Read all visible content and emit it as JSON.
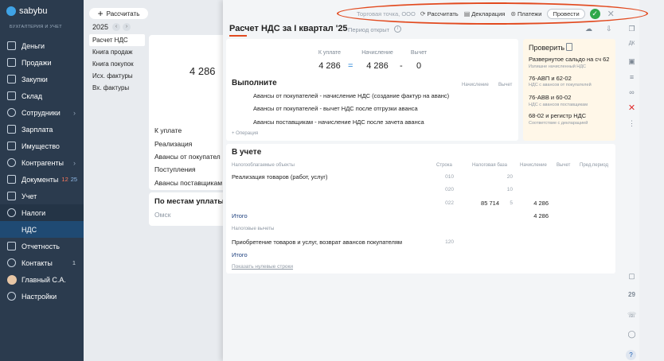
{
  "app": {
    "logo_text": "sabybu",
    "logo_subtitle": "БУХГАЛТЕРИЯ И УЧЕТ"
  },
  "sidebar": {
    "items": [
      {
        "label": "Деньги",
        "icon": "wallet-icon"
      },
      {
        "label": "Продажи",
        "icon": "cart-icon"
      },
      {
        "label": "Закупки",
        "icon": "box-icon"
      },
      {
        "label": "Склад",
        "icon": "warehouse-icon"
      },
      {
        "label": "Сотрудники",
        "icon": "people-icon",
        "chevron": "›"
      },
      {
        "label": "Зарплата",
        "icon": "salary-icon"
      },
      {
        "label": "Имущество",
        "icon": "building-icon"
      },
      {
        "label": "Контрагенты",
        "icon": "partners-icon",
        "chevron": "›"
      },
      {
        "label": "Документы",
        "icon": "documents-icon",
        "badge_red": "12",
        "badge_blue": "25"
      },
      {
        "label": "Учет",
        "icon": "ledger-icon"
      },
      {
        "label": "Налоги",
        "icon": "tax-icon"
      },
      {
        "label": "НДС",
        "icon": ""
      },
      {
        "label": "Отчетность",
        "icon": "report-icon"
      },
      {
        "label": "Контакты",
        "icon": "chat-icon",
        "count": "1"
      },
      {
        "label": "Главный С.А.",
        "icon": "avatar"
      },
      {
        "label": "Настройки",
        "icon": "gear-icon"
      }
    ]
  },
  "middle": {
    "calc_button": "Рассчитать",
    "year": "2025",
    "doc_list": [
      "Расчет НДС",
      "Книга продаж",
      "Книга покупок",
      "Исх. фактуры",
      "Вх. фактуры"
    ],
    "bg_value": "4 286",
    "bg_rows": [
      "К уплате",
      "Реализация",
      "Авансы от покупател",
      "Поступления",
      "Авансы поставщикам"
    ],
    "bg_section": "По местам уплаты",
    "bg_sub": "Омск"
  },
  "toolbar": {
    "org": "Торговая точка, ООО",
    "calc": "Рассчитать",
    "declaration": "Декларация",
    "payments": "Платежи",
    "post": "Провести",
    "ok_glyph": "✓",
    "close_glyph": "✕"
  },
  "doc": {
    "title": "Расчет НДС за I квартал '25",
    "period_status": "Период открыт",
    "summary": {
      "pay_label": "К уплате",
      "pay_value": "4 286",
      "accrual_label": "Начисление",
      "accrual_value": "4 286",
      "deduction_label": "Вычет",
      "deduction_value": "0",
      "eq": "=",
      "minus": "-"
    },
    "todo": {
      "title": "Выполните",
      "col_accrual": "Начисление",
      "col_deduction": "Вычет",
      "rows": [
        "Авансы от покупателей - начисление НДС (создание фактур на аванс)",
        "Авансы от покупателей - вычет НДС после отгрузки аванса",
        "Авансы поставщикам - начисление НДС после зачета аванса"
      ],
      "operation_link": "+ Операция"
    },
    "check": {
      "title": "Проверить",
      "items": [
        {
          "label": "Развернутое сальдо на сч 62",
          "sub": "Излишне начисленный НДС"
        },
        {
          "label": "76-АВП и 62-02",
          "sub": "НДС с авансов от покупателей"
        },
        {
          "label": "76-АВВ и 60-02",
          "sub": "НДС с авансов поставщикам"
        },
        {
          "label": "68-02 и регистр НДС",
          "sub": "Соответствие с декларацией"
        }
      ]
    },
    "accounting": {
      "title": "В учете",
      "headers": {
        "objects": "Налогооблагаемые объекты",
        "line": "Строка",
        "base": "Налоговая база",
        "accrual": "Начисление",
        "deduction": "Вычет",
        "prev": "Пред.период"
      },
      "sale_row": "Реализация товаров (работ, услуг)",
      "sale_lines": [
        {
          "line": "010",
          "base": "",
          "rate": "20",
          "accrual": ""
        },
        {
          "line": "020",
          "base": "",
          "rate": "10",
          "accrual": ""
        },
        {
          "line": "022",
          "base": "85 714",
          "rate": "5",
          "accrual": "4 286"
        }
      ],
      "total_label": "Итого",
      "total_value": "4 286",
      "deductions_header": "Налоговые вычеты",
      "purchase_row": "Приобретение товаров и услуг, возврат авансов покупателям",
      "purchase_line": "120",
      "total2_label": "Итого",
      "show_zero": "Показать нулевые строки"
    }
  },
  "right_tools": {
    "calendar_day": "29",
    "help": "?"
  }
}
